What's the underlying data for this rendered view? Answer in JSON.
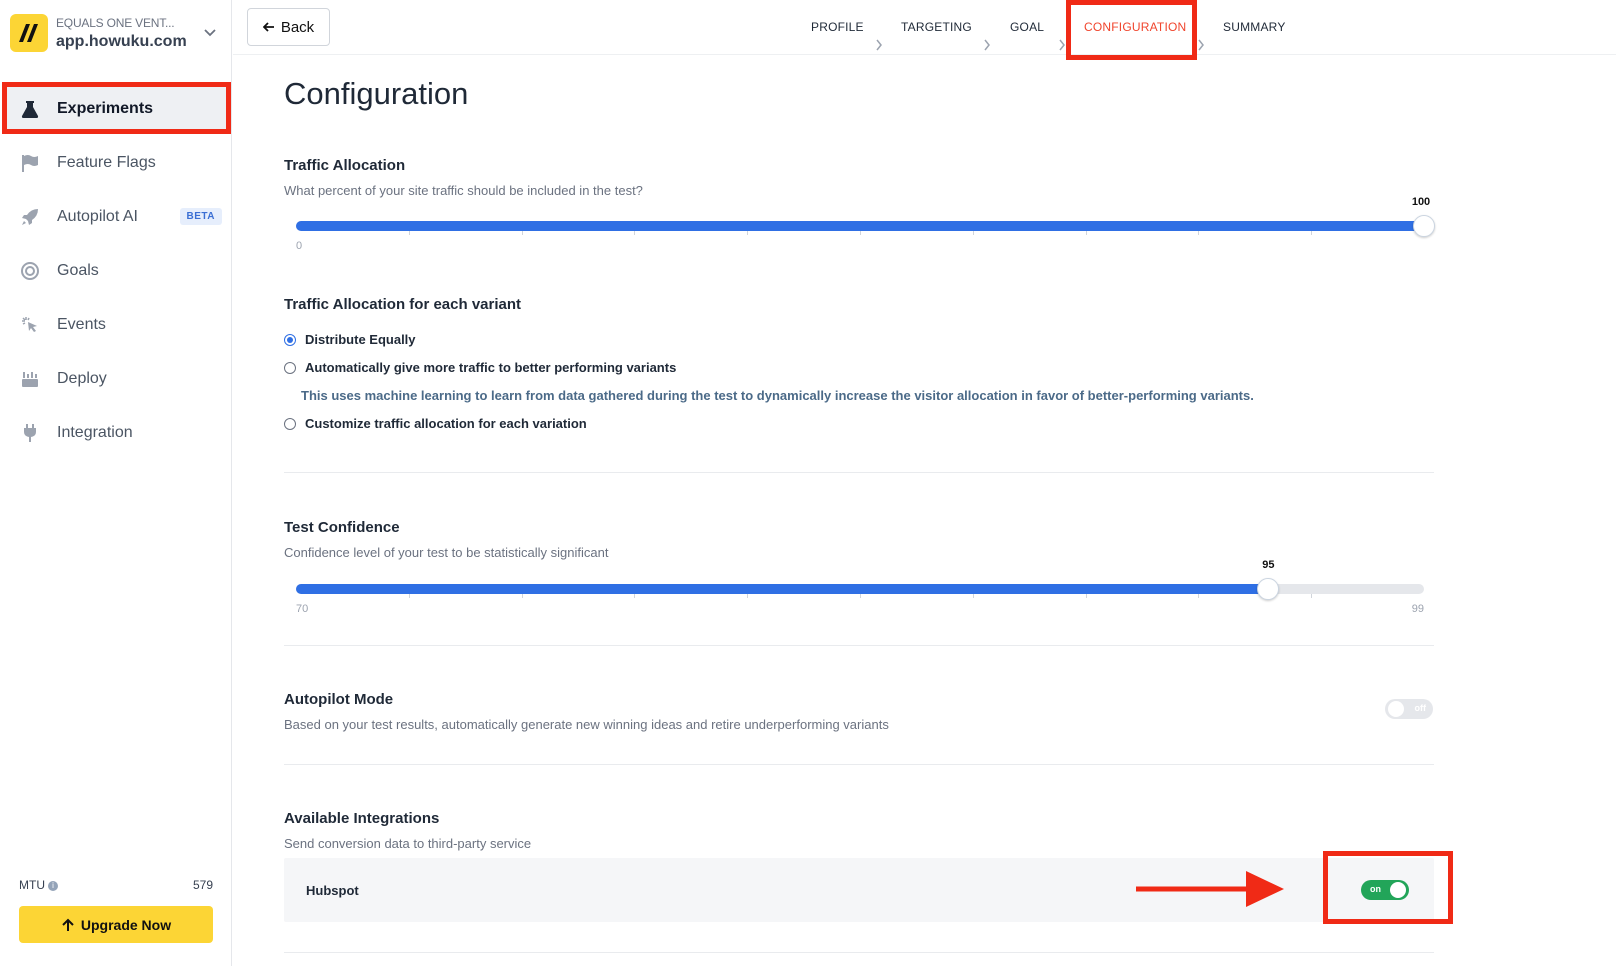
{
  "workspace": {
    "org": "EQUALS ONE VENT...",
    "domain": "app.howuku.com"
  },
  "sidebar": {
    "items": [
      {
        "label": "Experiments",
        "icon": "flask-icon"
      },
      {
        "label": "Feature Flags",
        "icon": "flag-icon"
      },
      {
        "label": "Autopilot AI",
        "icon": "rocket-icon",
        "badge": "BETA"
      },
      {
        "label": "Goals",
        "icon": "target-icon"
      },
      {
        "label": "Events",
        "icon": "cursor-click-icon"
      },
      {
        "label": "Deploy",
        "icon": "deploy-icon"
      },
      {
        "label": "Integration",
        "icon": "plug-icon"
      }
    ],
    "active": "Experiments"
  },
  "mtu": {
    "label": "MTU",
    "value": "579"
  },
  "upgrade": {
    "label": "Upgrade Now"
  },
  "topbar": {
    "back_label": "Back",
    "steps": [
      "PROFILE",
      "TARGETING",
      "GOAL",
      "CONFIGURATION",
      "SUMMARY"
    ],
    "active_step": "CONFIGURATION"
  },
  "page": {
    "title": "Configuration"
  },
  "traffic_allocation": {
    "title": "Traffic Allocation",
    "description": "What percent of your site traffic should be included in the test?",
    "min": "0",
    "value": "100",
    "max_value": 100
  },
  "variant_allocation": {
    "title": "Traffic Allocation for each variant",
    "options": [
      {
        "label": "Distribute Equally",
        "checked": true
      },
      {
        "label": "Automatically give more traffic to better performing variants",
        "checked": false
      },
      {
        "label": "Customize traffic allocation for each variation",
        "checked": false
      }
    ],
    "note": "This uses machine learning to learn from data gathered during the test to dynamically increase the visitor allocation in favor of better-performing variants."
  },
  "test_confidence": {
    "title": "Test Confidence",
    "description": "Confidence level of your test to be statistically significant",
    "min": "70",
    "max": "99",
    "value": "95"
  },
  "autopilot_mode": {
    "title": "Autopilot Mode",
    "description": "Based on your test results, automatically generate new winning ideas and retire underperforming variants",
    "toggle_label": "off"
  },
  "integrations": {
    "title": "Available Integrations",
    "description": "Send conversion data to third-party service",
    "items": [
      {
        "name": "Hubspot",
        "toggle_label": "on"
      }
    ]
  },
  "colors": {
    "accent": "#2f6fe4",
    "highlight": "#f02a16",
    "toggle_on": "#22a559",
    "brand": "#fcd535"
  }
}
